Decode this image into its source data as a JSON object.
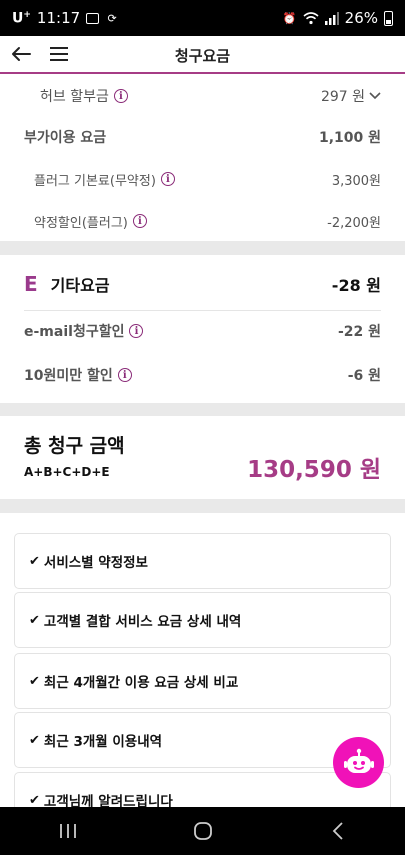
{
  "status_bar": {
    "carrier": "U",
    "carrier_sup": "+",
    "time": "11:17",
    "battery": "26%"
  },
  "header": {
    "title": "청구요금"
  },
  "section_d": {
    "hub_installment": {
      "label": "허브 할부금",
      "value": "297 원"
    },
    "extra_usage": {
      "label": "부가이용 요금",
      "value": "1,100 원"
    },
    "plug_basic": {
      "label": "플러그 기본료(무약정)",
      "value": "3,300원"
    },
    "plug_discount": {
      "label": "약정할인(플러그)",
      "value": "-2,200원"
    }
  },
  "section_e": {
    "badge": "E",
    "title": "기타요금",
    "total": "-28 원",
    "items": [
      {
        "label": "e-mail청구할인",
        "value": "-22 원"
      },
      {
        "label": "10원미만 할인",
        "value": "-6 원"
      }
    ]
  },
  "total": {
    "title": "총 청구 금액",
    "formula": "A+B+C+D+E",
    "amount": "130,590 원"
  },
  "links": [
    {
      "label": "서비스별 약정정보"
    },
    {
      "label": "고객별 결합 서비스 요금 상세 내역"
    },
    {
      "label": "최근 4개월간 이용 요금 상세 비교"
    },
    {
      "label": "최근 3개월 이용내역"
    },
    {
      "label": "고객님께 알려드립니다"
    }
  ],
  "colors": {
    "accent": "#a63c86",
    "chatbot": "#f012b8",
    "separator": "#e9e9e9"
  }
}
